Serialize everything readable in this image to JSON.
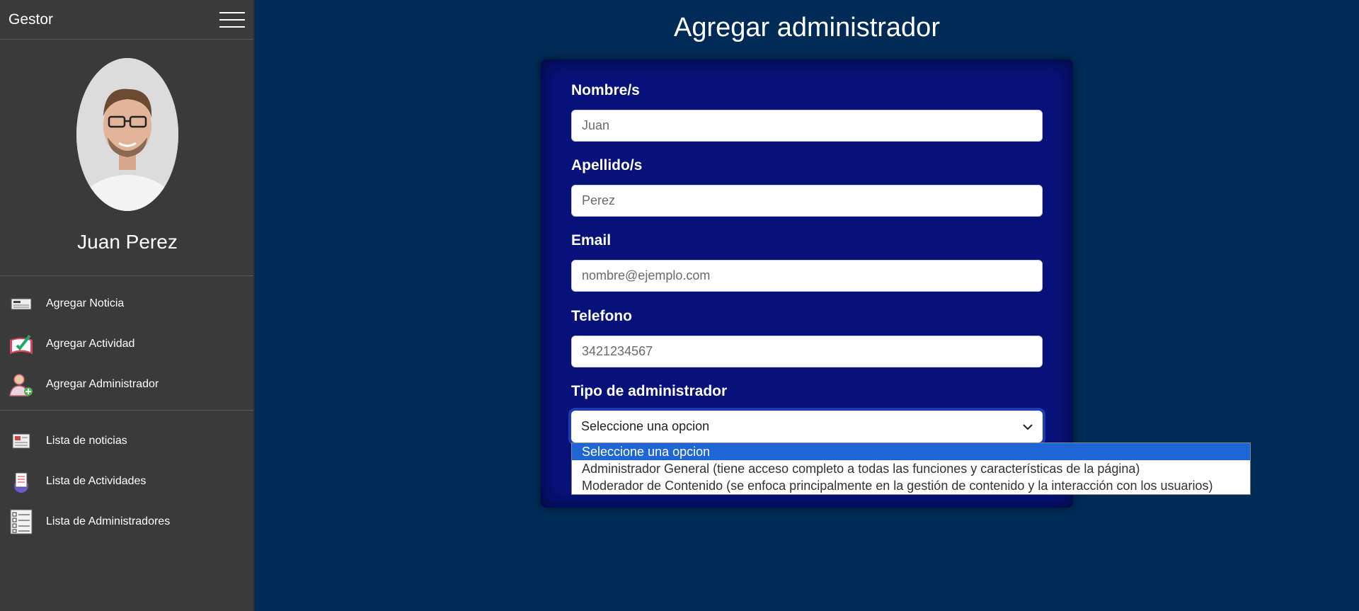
{
  "sidebar": {
    "brand": "Gestor",
    "profile_name": "Juan Perez",
    "items_group1": [
      {
        "label": "Agregar Noticia",
        "icon": "newspaper-icon"
      },
      {
        "label": "Agregar Actividad",
        "icon": "activity-book-icon"
      },
      {
        "label": "Agregar Administrador",
        "icon": "add-user-icon"
      }
    ],
    "items_group2": [
      {
        "label": "Lista de noticias",
        "icon": "news-list-icon"
      },
      {
        "label": "Lista de Actividades",
        "icon": "activity-list-icon"
      },
      {
        "label": "Lista de Administradores",
        "icon": "checklist-icon"
      }
    ]
  },
  "main": {
    "title": "Agregar administrador",
    "form": {
      "nombre_label": "Nombre/s",
      "nombre_placeholder": "Juan",
      "apellido_label": "Apellido/s",
      "apellido_placeholder": "Perez",
      "email_label": "Email",
      "email_placeholder": "nombre@ejemplo.com",
      "telefono_label": "Telefono",
      "telefono_placeholder": "3421234567",
      "tipo_label": "Tipo de administrador",
      "tipo_selected": "Seleccione una opcion",
      "tipo_options": [
        "Seleccione una opcion",
        "Administrador General (tiene acceso completo a todas las funciones y características de la página)",
        "Moderador de Contenido (se enfoca principalmente en la gestión de contenido y la interacción con los usuarios)"
      ]
    }
  },
  "colors": {
    "background": "#002b57",
    "sidebar": "#3a3a3a",
    "card": "#06127a",
    "selected_option": "#1e66d6"
  }
}
